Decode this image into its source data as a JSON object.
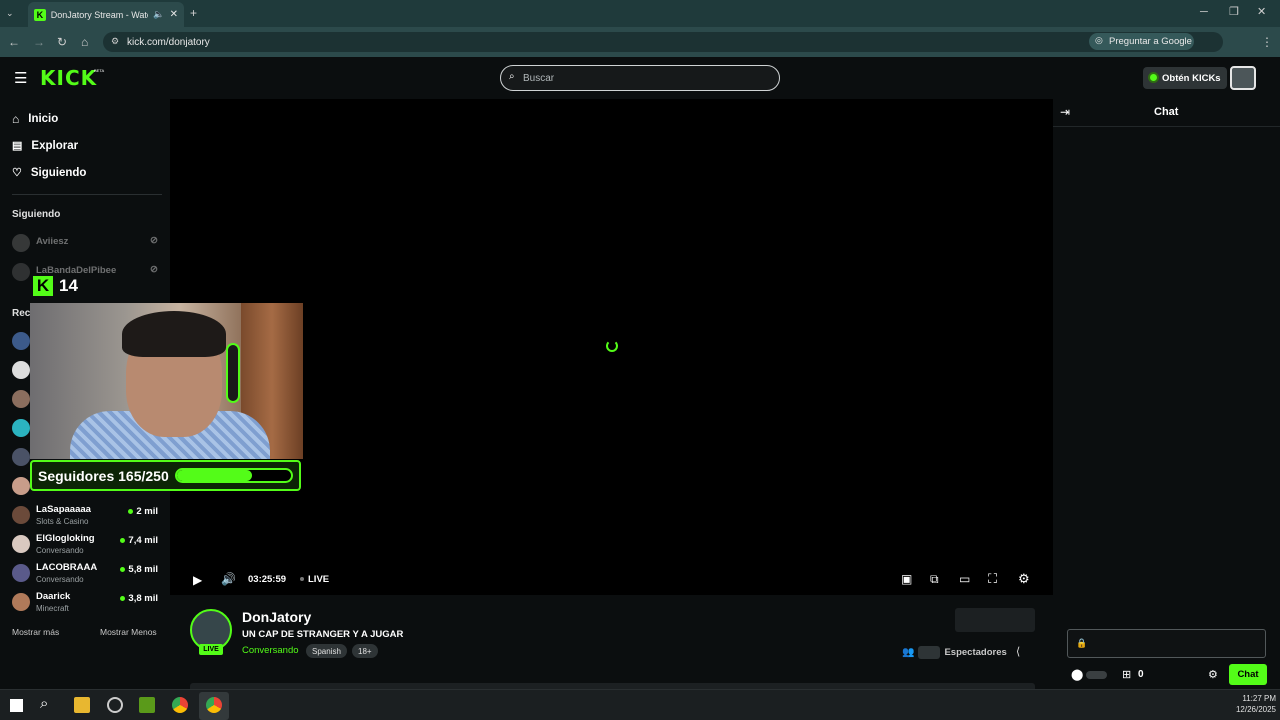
{
  "browser": {
    "tab_title": "DonJatory Stream - Watch l",
    "url": "kick.com/donjatory",
    "google_button": "Preguntar a Google"
  },
  "header": {
    "logo": "KICK",
    "logo_sup": "BETA",
    "search_placeholder": "Buscar",
    "get_kicks": "Obtén KICKs"
  },
  "sidebar": {
    "nav": [
      {
        "label": "Inicio",
        "icon": "home-icon"
      },
      {
        "label": "Explorar",
        "icon": "explore-icon"
      },
      {
        "label": "Siguiendo",
        "icon": "heart-icon"
      }
    ],
    "following_header": "Siguiendo",
    "following": [
      {
        "name": "Aviiesz"
      },
      {
        "name": "LaBandaDelPibee"
      }
    ],
    "recommended_header": "Rec",
    "recommended": [
      {
        "name": "LaSapaaaaa",
        "category": "Slots & Casino",
        "viewers": "2 mil"
      },
      {
        "name": "ElGlogloking",
        "category": "Conversando",
        "viewers": "7,4 mil"
      },
      {
        "name": "LACOBRAAA",
        "category": "Conversando",
        "viewers": "5,8 mil"
      },
      {
        "name": "Daarick",
        "category": "Minecraft",
        "viewers": "3,8 mil"
      }
    ],
    "show_more": "Mostrar más",
    "show_less": "Mostrar Menos"
  },
  "overlay": {
    "k_count": "14",
    "goal_text": "Seguidores 165/250",
    "goal_fraction": 0.66
  },
  "player": {
    "time": "03:25:59",
    "live_label": "LIVE"
  },
  "stream": {
    "streamer": "DonJatory",
    "live_badge": "LIVE",
    "title": "UN CAP DE STRANGER Y A JUGAR",
    "category": "Conversando",
    "tags": [
      "Spanish",
      "18+"
    ],
    "viewers_label": "Espectadores"
  },
  "chat": {
    "title": "Chat",
    "points": "0",
    "send_label": "Chat"
  },
  "taskbar": {
    "time": "11:27 PM",
    "date": "12/26/2025"
  },
  "colors": {
    "accent": "#53fc18",
    "bg": "#0b0e0f"
  }
}
